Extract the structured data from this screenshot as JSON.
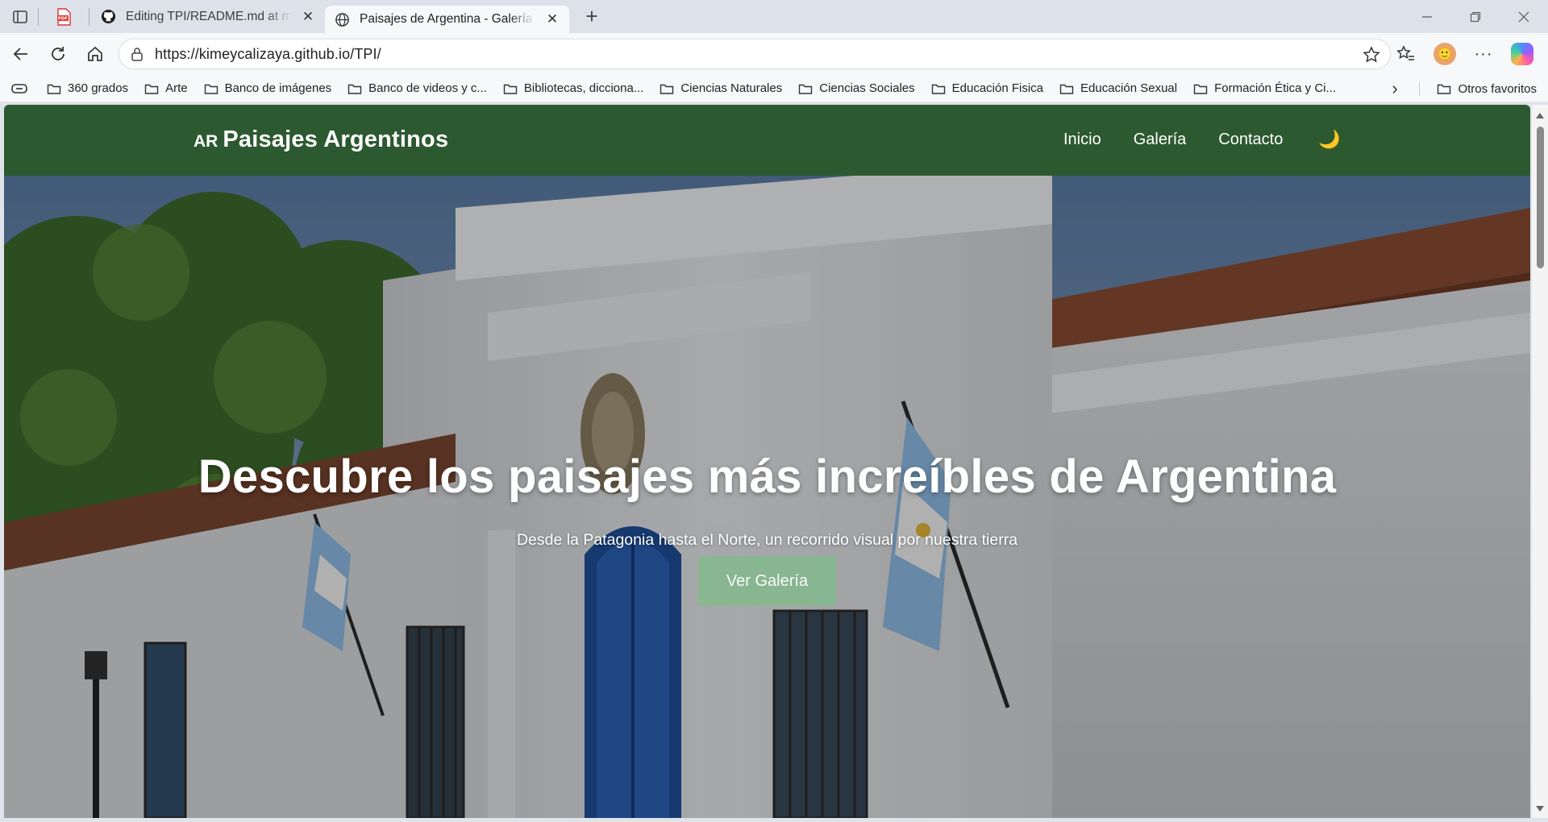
{
  "browser": {
    "tabs": [
      {
        "title": "",
        "kind": "pdf-pinned",
        "icon": "pdf-icon"
      },
      {
        "title": "Editing TPI/README.md at main · kimeycalizaya/TPI",
        "icon": "github-icon"
      },
      {
        "title": "Paisajes de Argentina - Galería Interactiva",
        "icon": "globe-icon",
        "active": true
      }
    ],
    "new_tab_label": "+",
    "address": {
      "url": "https://kimeycalizaya.github.io/TPI/"
    },
    "bookmarks": [
      "360 grados",
      "Arte",
      "Banco de imágenes",
      "Banco de videos y c...",
      "Bibliotecas, dicciona...",
      "Ciencias Naturales",
      "Ciencias Sociales",
      "Educación Fisica",
      "Educación Sexual",
      "Formación Ética y Ci..."
    ],
    "other_bookmarks": "Otros favoritos"
  },
  "site": {
    "brand": {
      "flag": "AR",
      "name": "Paisajes Argentinos"
    },
    "nav": [
      "Inicio",
      "Galería",
      "Contacto"
    ],
    "theme_toggle_icon": "moon-icon",
    "colors": {
      "header": "#2d5930",
      "button": "#86b790"
    },
    "hero": {
      "title": "Descubre los paisajes más increíbles de Argentina",
      "subtitle": "Desde la Patagonia hasta el Norte, un recorrido visual por nuestra tierra",
      "button": "Ver Galería"
    }
  }
}
